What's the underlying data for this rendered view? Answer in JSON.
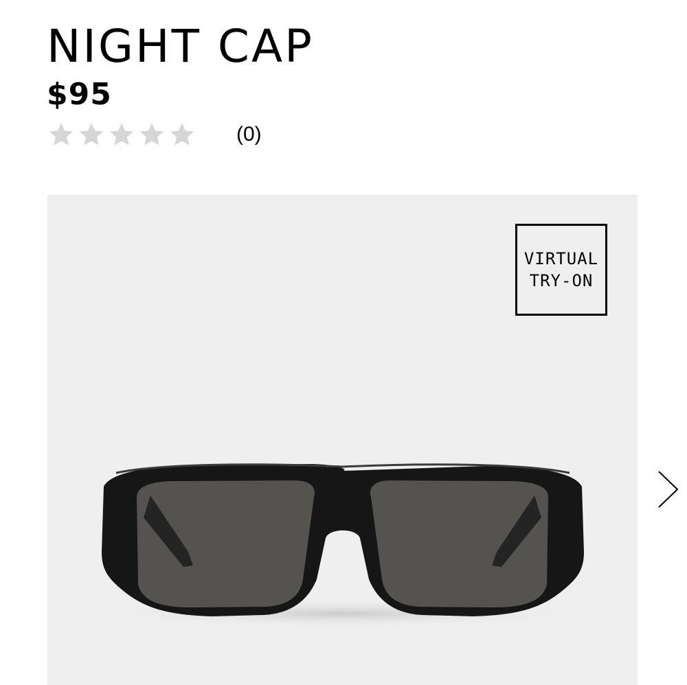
{
  "product": {
    "name": "NIGHT CAP",
    "price": "$95",
    "rating": {
      "value": 0,
      "max": 5,
      "count_label": "(0)",
      "star_color": "#d6d6d6"
    }
  },
  "gallery": {
    "background": "#efefef",
    "try_on_line1": "VIRTUAL",
    "try_on_line2": "TRY-ON",
    "image_icon": "sunglasses-product-image",
    "next_icon": "chevron-right-icon"
  }
}
